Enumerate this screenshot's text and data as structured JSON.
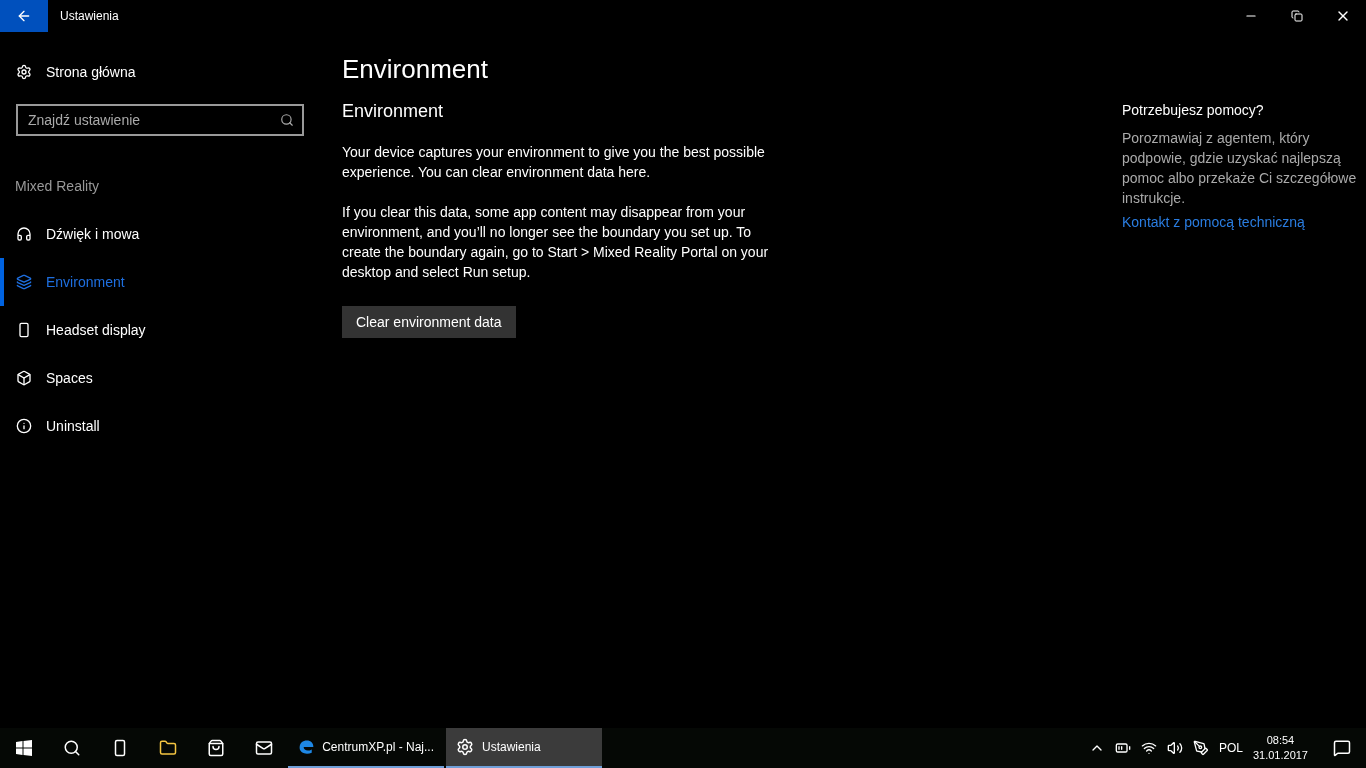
{
  "window": {
    "title": "Ustawienia"
  },
  "sidebar": {
    "home": "Strona główna",
    "search": {
      "placeholder": "Znajdź ustawienie"
    },
    "section": "Mixed Reality",
    "items": [
      {
        "label": "Dźwięk i mowa",
        "selected": false
      },
      {
        "label": "Environment",
        "selected": true
      },
      {
        "label": "Headset display",
        "selected": false
      },
      {
        "label": "Spaces",
        "selected": false
      },
      {
        "label": "Uninstall",
        "selected": false
      }
    ]
  },
  "content": {
    "title": "Environment",
    "subtitle": "Environment",
    "paragraphs": [
      "Your device captures your environment to give you the best possible experience. You can clear environment data here.",
      "If you clear this data, some app content may disappear from your environment, and you’ll no longer see the boundary you set up. To create the boundary again, go to Start > Mixed Reality Portal on your desktop and select Run setup."
    ],
    "button": "Clear environment data"
  },
  "help": {
    "title": "Potrzebujesz pomocy?",
    "text": "Porozmawiaj z agentem, który podpowie, gdzie uzyskać najlepszą pomoc albo przekaże Ci szczegółowe instrukcje.",
    "link": "Kontakt z pomocą techniczną"
  },
  "taskbar": {
    "apps": [
      {
        "label": "CentrumXP.pl - Naj...",
        "selected": false
      },
      {
        "label": "Ustawienia",
        "selected": true
      }
    ],
    "language": "POL",
    "time": "08:54",
    "date": "31.01.2017"
  }
}
